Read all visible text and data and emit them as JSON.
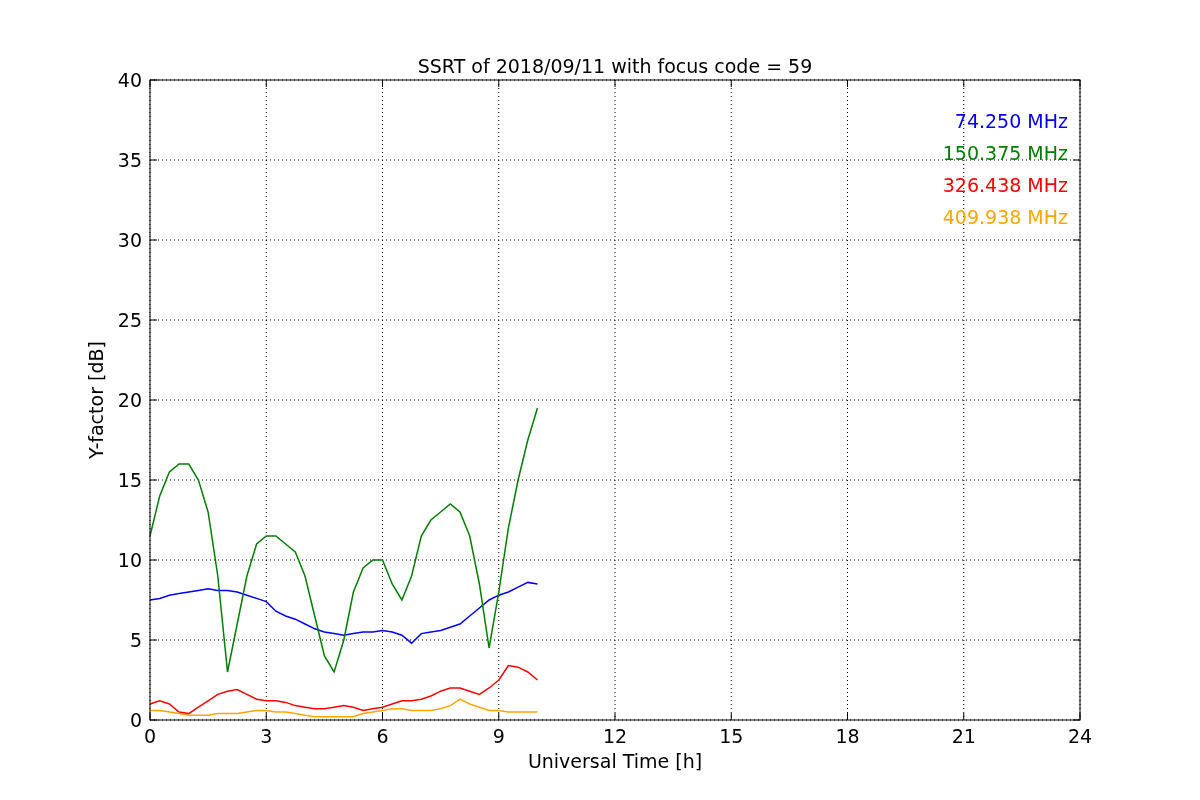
{
  "figure": {
    "chart_data": {
      "type": "line",
      "title": "SSRT of 2018/09/11 with focus code = 59",
      "xlabel": "Universal Time [h]",
      "ylabel": "Y-factor [dB]",
      "x": [
        0,
        0.25,
        0.5,
        0.75,
        1,
        1.25,
        1.5,
        1.75,
        2,
        2.25,
        2.5,
        2.75,
        3,
        3.25,
        3.5,
        3.75,
        4,
        4.25,
        4.5,
        4.75,
        5,
        5.25,
        5.5,
        5.75,
        6,
        6.25,
        6.5,
        6.75,
        7,
        7.25,
        7.5,
        7.75,
        8,
        8.25,
        8.5,
        8.75,
        9,
        9.25,
        9.5,
        9.75,
        10
      ],
      "series": [
        {
          "name": "74.250 MHz",
          "color": "#0000ff",
          "values": [
            7.5,
            7.6,
            7.8,
            7.9,
            8.0,
            8.1,
            8.2,
            8.1,
            8.1,
            8.0,
            7.8,
            7.6,
            7.4,
            6.8,
            6.5,
            6.3,
            6.0,
            5.7,
            5.5,
            5.4,
            5.3,
            5.4,
            5.5,
            5.5,
            5.6,
            5.5,
            5.3,
            4.8,
            5.4,
            5.5,
            5.6,
            5.8,
            6.0,
            6.5,
            7.0,
            7.5,
            7.8,
            8.0,
            8.3,
            8.6,
            8.5
          ]
        },
        {
          "name": "150.375 MHz",
          "color": "#008000",
          "values": [
            11.5,
            14,
            15.5,
            16,
            16,
            15,
            13,
            9,
            3,
            6,
            9,
            11,
            11.5,
            11.5,
            11,
            10.5,
            9,
            6.5,
            4,
            3,
            5,
            8,
            9.5,
            10,
            10,
            8.5,
            7.5,
            9,
            11.5,
            12.5,
            13,
            13.5,
            13,
            11.5,
            8.5,
            4.5,
            8,
            12,
            15,
            17.5,
            19.5
          ]
        },
        {
          "name": "326.438 MHz",
          "color": "#ff0000",
          "values": [
            1.0,
            1.2,
            1.0,
            0.5,
            0.4,
            0.8,
            1.2,
            1.6,
            1.8,
            1.9,
            1.6,
            1.3,
            1.2,
            1.2,
            1.1,
            0.9,
            0.8,
            0.7,
            0.7,
            0.8,
            0.9,
            0.8,
            0.6,
            0.7,
            0.8,
            1.0,
            1.2,
            1.2,
            1.3,
            1.5,
            1.8,
            2.0,
            2.0,
            1.8,
            1.6,
            2.0,
            2.5,
            3.4,
            3.3,
            3.0,
            2.5
          ]
        },
        {
          "name": "409.938 MHz",
          "color": "#ffa500",
          "values": [
            0.6,
            0.6,
            0.5,
            0.4,
            0.3,
            0.3,
            0.3,
            0.4,
            0.4,
            0.4,
            0.5,
            0.6,
            0.6,
            0.5,
            0.5,
            0.4,
            0.3,
            0.2,
            0.2,
            0.2,
            0.2,
            0.2,
            0.4,
            0.5,
            0.6,
            0.7,
            0.7,
            0.6,
            0.6,
            0.6,
            0.7,
            0.9,
            1.3,
            1.0,
            0.8,
            0.6,
            0.6,
            0.5,
            0.5,
            0.5,
            0.5
          ]
        }
      ],
      "grid": true,
      "xlim": [
        0,
        24
      ],
      "ylim": [
        0,
        40
      ],
      "xticks": [
        0,
        3,
        6,
        9,
        12,
        15,
        18,
        21,
        24
      ],
      "yticks": [
        0,
        5,
        10,
        15,
        20,
        25,
        30,
        35,
        40
      ]
    }
  }
}
